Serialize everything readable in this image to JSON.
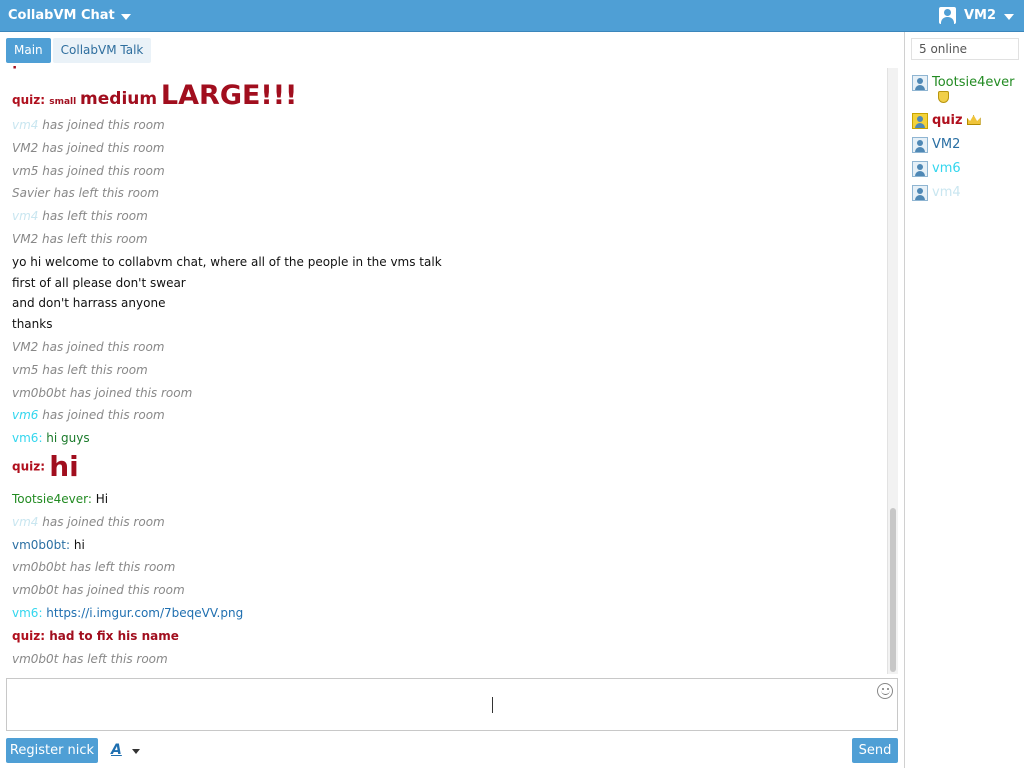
{
  "app": {
    "title": "CollabVM Chat",
    "username": "VM2"
  },
  "tabs": [
    {
      "label": "Main"
    },
    {
      "label": "CollabVM Talk"
    }
  ],
  "messages": [
    {
      "n": "quiz",
      "sep": ": ",
      "t1": "small",
      "t2": "medium",
      "t3": "LARGE!!!"
    },
    {
      "n": "vm4",
      "t": " has joined this room"
    },
    {
      "t": "VM2 has joined this room"
    },
    {
      "t": "vm5 has joined this room"
    },
    {
      "t": "Savier has left this room"
    },
    {
      "n": "vm4",
      "t": " has left this room"
    },
    {
      "t": "VM2 has left this room"
    },
    {
      "t": "yo hi welcome to collabvm chat, where all of the people in the vms talk"
    },
    {
      "t": "first of all please don't swear"
    },
    {
      "t": "and don't harrass anyone"
    },
    {
      "t": "thanks"
    },
    {
      "t": "VM2 has joined this room"
    },
    {
      "t": "vm5 has left this room"
    },
    {
      "t": "vm0b0bt has joined this room"
    },
    {
      "n": "vm6",
      "t": " has joined this room"
    },
    {
      "n": "vm6",
      "sep": ": ",
      "t": "hi guys"
    },
    {
      "n": "quiz",
      "sep": ": ",
      "t": "hi"
    },
    {
      "n": "Tootsie4ever",
      "sep": ": ",
      "t": "Hi"
    },
    {
      "n": "vm4",
      "t": " has joined this room"
    },
    {
      "n": "vm0b0bt",
      "sep": ": ",
      "t": "hi"
    },
    {
      "t": "vm0b0bt has left this room"
    },
    {
      "t": "vm0b0t has joined this room"
    },
    {
      "n": "vm6",
      "sep": ": ",
      "t": "https://i.imgur.com/7beqeVV.png"
    },
    {
      "n": "quiz",
      "sep": ": ",
      "t": "had to fix his name"
    },
    {
      "t": "vm0b0t has left this room"
    }
  ],
  "footer": {
    "register_label": "Register nick",
    "font_label": "A",
    "send_label": "Send"
  },
  "sidebar": {
    "online_count": "5 online",
    "users": [
      {
        "name": "Tootsie4ever",
        "color": "#228b22",
        "badge": "shield-icon"
      },
      {
        "name": "quiz",
        "color": "#b0101e",
        "badge": "crown-icon"
      },
      {
        "name": "VM2",
        "color": "#2a6fa3"
      },
      {
        "name": "vm6",
        "color": "#33d6ee"
      },
      {
        "name": "vm4",
        "color": "#c9e6f0"
      }
    ]
  },
  "colors": {
    "accent": "#4f9fd5",
    "quiz": "#b0101e",
    "vm6": "#33d6ee",
    "tootsie": "#228b22",
    "system": "#888888"
  }
}
